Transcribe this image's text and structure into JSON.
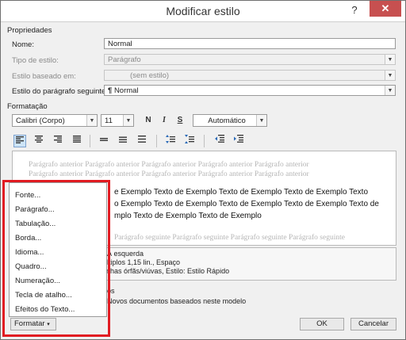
{
  "window": {
    "title": "Modificar estilo",
    "help_glyph": "?",
    "close_glyph": "✕"
  },
  "properties": {
    "section": "Propriedades",
    "name_label": "Nome:",
    "name_value": "Normal",
    "type_label": "Tipo de estilo:",
    "type_value": "Parágrafo",
    "based_label": "Estilo baseado em:",
    "based_value": "(sem estilo)",
    "next_label": "Estilo do parágrafo seguinte:",
    "next_value": "Normal",
    "next_glyph": "¶"
  },
  "formatting": {
    "section": "Formatação",
    "font": "Calibri (Corpo)",
    "size": "11",
    "bold": "N",
    "italic": "I",
    "underline": "S",
    "color": "Automático"
  },
  "preview": {
    "previous_text": "Parágrafo anterior Parágrafo anterior Parágrafo anterior Parágrafo anterior Parágrafo anterior",
    "sample_line1": "e Exemplo Texto de Exemplo Texto de Exemplo Texto de Exemplo Texto",
    "sample_line2": "o Exemplo Texto de Exemplo Texto de Exemplo Texto de Exemplo Texto de",
    "sample_line3": "mplo Texto de Exemplo Texto de Exemplo",
    "next_text": "Parágrafo seguinte Parágrafo seguinte Parágrafo seguinte Parágrafo seguinte"
  },
  "description": {
    "line1": ", À esquerda",
    "line2": "últiplos 1,15 lin., Espaço",
    "line3": "linhas órfãs/viúvas, Estilo: Estilo Rápido"
  },
  "options": {
    "quick_style_fragment": "os",
    "new_docs": "Novos documentos baseados neste modelo"
  },
  "menu": {
    "items": [
      "Fonte...",
      "Parágrafo...",
      "Tabulação...",
      "Borda...",
      "Idioma...",
      "Quadro...",
      "Numeração...",
      "Tecla de atalho...",
      "Efeitos do Texto..."
    ]
  },
  "buttons": {
    "format": "Formatar",
    "format_arrow": "▾",
    "ok": "OK",
    "cancel": "Cancelar"
  },
  "colors": {
    "highlight": "#e11b22",
    "close": "#c75050"
  }
}
